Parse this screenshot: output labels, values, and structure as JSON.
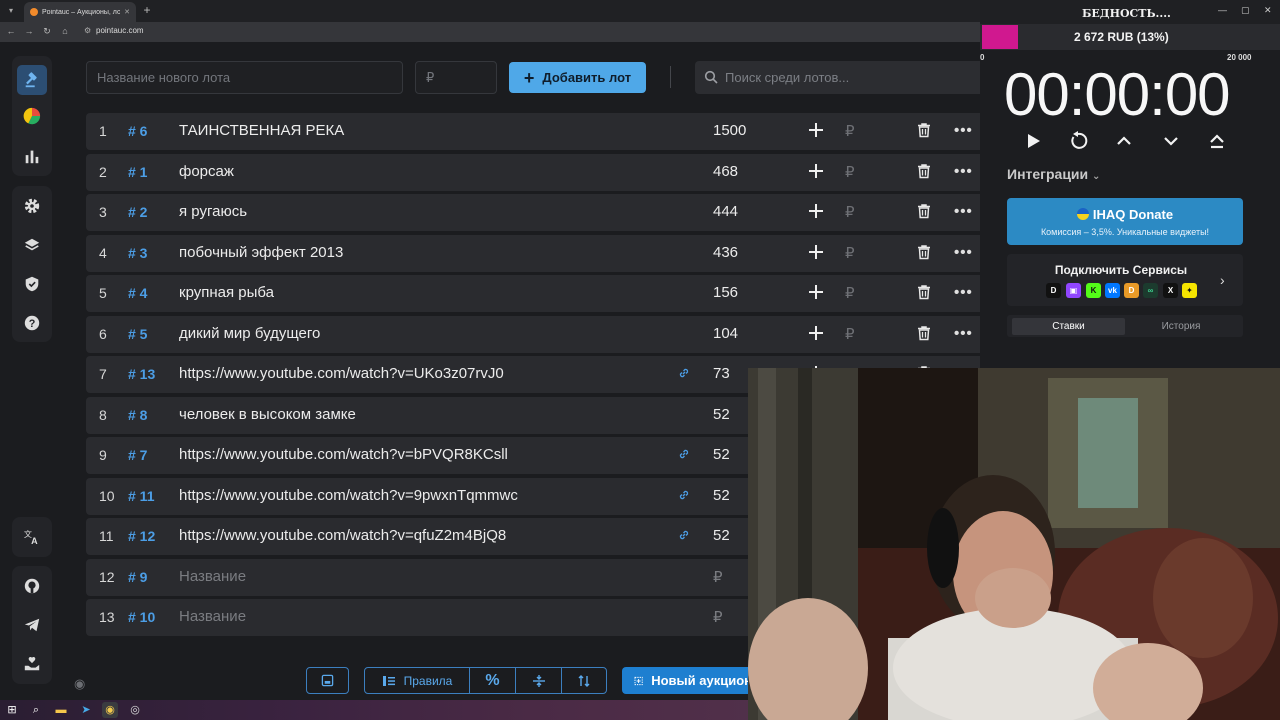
{
  "browser": {
    "tab_title": "Pointauc – Аукционы, лотереи",
    "url": "pointauc.com"
  },
  "lot_input": {
    "placeholder": "Название нового лота"
  },
  "amount_input": {
    "placeholder": "₽"
  },
  "add_button": {
    "label": "Добавить лот"
  },
  "search": {
    "placeholder": "Поиск среди лотов..."
  },
  "lots": [
    {
      "n": "1",
      "id": "# 6",
      "name": "ТАИНСТВЕННАЯ РЕКА",
      "amount": "1500",
      "link": false,
      "placeholder": false
    },
    {
      "n": "2",
      "id": "# 1",
      "name": "форсаж",
      "amount": "468",
      "link": false,
      "placeholder": false
    },
    {
      "n": "3",
      "id": "# 2",
      "name": "я ругаюсь",
      "amount": "444",
      "link": false,
      "placeholder": false
    },
    {
      "n": "4",
      "id": "# 3",
      "name": "побочный эффект 2013",
      "amount": "436",
      "link": false,
      "placeholder": false
    },
    {
      "n": "5",
      "id": "# 4",
      "name": "крупная рыба",
      "amount": "156",
      "link": false,
      "placeholder": false
    },
    {
      "n": "6",
      "id": "# 5",
      "name": "дикий мир будущего",
      "amount": "104",
      "link": false,
      "placeholder": false
    },
    {
      "n": "7",
      "id": "# 13",
      "name": "https://www.youtube.com/watch?v=UKo3z07rvJ0",
      "amount": "73",
      "link": true,
      "placeholder": false
    },
    {
      "n": "8",
      "id": "# 8",
      "name": "человек в высоком замке",
      "amount": "52",
      "link": false,
      "placeholder": false
    },
    {
      "n": "9",
      "id": "# 7",
      "name": "https://www.youtube.com/watch?v=bPVQR8KCsll",
      "amount": "52",
      "link": true,
      "placeholder": false
    },
    {
      "n": "10",
      "id": "# 11",
      "name": "https://www.youtube.com/watch?v=9pwxnTqmmwc",
      "amount": "52",
      "link": true,
      "placeholder": false
    },
    {
      "n": "11",
      "id": "# 12",
      "name": "https://www.youtube.com/watch?v=qfuZ2m4BjQ8",
      "amount": "52",
      "link": true,
      "placeholder": false
    },
    {
      "n": "12",
      "id": "# 9",
      "name": "Название",
      "amount": "₽",
      "link": false,
      "placeholder": true
    },
    {
      "n": "13",
      "id": "# 10",
      "name": "Название",
      "amount": "₽",
      "link": false,
      "placeholder": true
    }
  ],
  "row_currency": "₽",
  "bottom": {
    "rules_label": "Правила",
    "new_auction_label": "Новый аукцион"
  },
  "overlay": {
    "title": "БЕДНОСТЬ....",
    "bar_text": "2 672 RUB (13%)",
    "bar_progress": 0.13,
    "bar_min": "0",
    "bar_max": "20 000",
    "timer": "00:00:00",
    "integrations": "Интеграции",
    "donate_title": "IHAQ Donate",
    "donate_sub": "Комиссия – 3,5%. Уникальные виджеты!",
    "connect_title": "Подключить Сервисы",
    "tab_bets": "Ставки",
    "tab_history": "История"
  },
  "colors": {
    "accent": "#4fa8e8",
    "hash": "#4c9ee6",
    "bar_fill": "#d0188f",
    "donate": "#2c8ac4"
  }
}
